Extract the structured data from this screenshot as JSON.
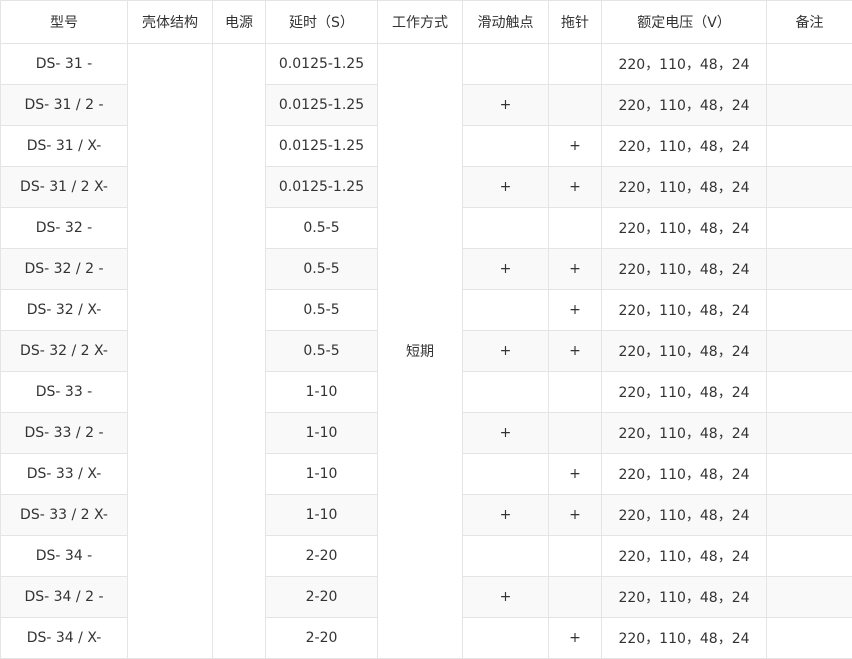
{
  "headers": [
    "型号",
    "壳体结构",
    "电源",
    "延时（S）",
    "工作方式",
    "滑动触点",
    "拖针",
    "额定电压（V）",
    "备注"
  ],
  "work_mode": "短期",
  "rows": [
    {
      "model": "DS- 31 -",
      "delay": "0.0125-1.25",
      "slide": "",
      "needle": "",
      "voltage": "220，110，48，24"
    },
    {
      "model": "DS- 31 / 2 -",
      "delay": "0.0125-1.25",
      "slide": "+",
      "needle": "",
      "voltage": "220，110，48，24"
    },
    {
      "model": "DS- 31 / X-",
      "delay": "0.0125-1.25",
      "slide": "",
      "needle": "+",
      "voltage": "220，110，48，24"
    },
    {
      "model": "DS- 31 / 2 X-",
      "delay": "0.0125-1.25",
      "slide": "+",
      "needle": "+",
      "voltage": "220，110，48，24"
    },
    {
      "model": "DS- 32 -",
      "delay": "0.5-5",
      "slide": "",
      "needle": "",
      "voltage": "220，110，48，24"
    },
    {
      "model": "DS- 32 / 2 -",
      "delay": "0.5-5",
      "slide": "+",
      "needle": "+",
      "voltage": "220，110，48，24"
    },
    {
      "model": "DS- 32 / X-",
      "delay": "0.5-5",
      "slide": "",
      "needle": "+",
      "voltage": "220，110，48，24"
    },
    {
      "model": "DS- 32 / 2 X-",
      "delay": "0.5-5",
      "slide": "+",
      "needle": "+",
      "voltage": "220，110，48，24"
    },
    {
      "model": "DS- 33 -",
      "delay": "1-10",
      "slide": "",
      "needle": "",
      "voltage": "220，110，48，24"
    },
    {
      "model": "DS- 33 / 2 -",
      "delay": "1-10",
      "slide": "+",
      "needle": "",
      "voltage": "220，110，48，24"
    },
    {
      "model": "DS- 33 / X-",
      "delay": "1-10",
      "slide": "",
      "needle": "+",
      "voltage": "220，110，48，24"
    },
    {
      "model": "DS- 33 / 2 X-",
      "delay": "1-10",
      "slide": "+",
      "needle": "+",
      "voltage": "220，110，48，24"
    },
    {
      "model": "DS- 34 -",
      "delay": "2-20",
      "slide": "",
      "needle": "",
      "voltage": "220，110，48，24"
    },
    {
      "model": "DS- 34 / 2 -",
      "delay": "2-20",
      "slide": "+",
      "needle": "",
      "voltage": "220，110，48，24"
    },
    {
      "model": "DS- 34 / X-",
      "delay": "2-20",
      "slide": "",
      "needle": "+",
      "voltage": "220，110，48，24"
    }
  ]
}
